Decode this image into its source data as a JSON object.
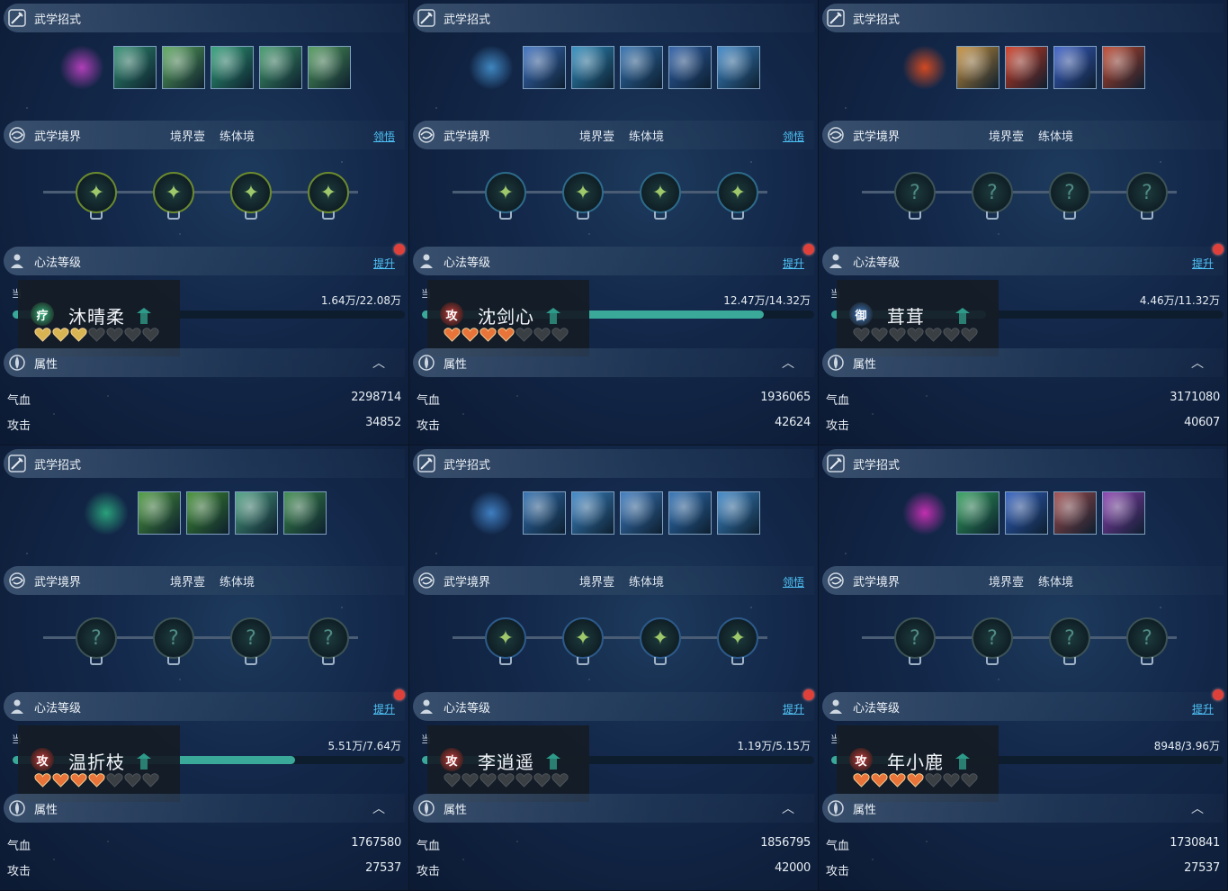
{
  "labels": {
    "skills_title": "武学招式",
    "realm_title": "武学境界",
    "realm_stage": "境界壹",
    "realm_name": "练体境",
    "comprehend_link": "领悟",
    "mind_title": "心法等级",
    "upgrade_link": "提升",
    "attr_title": "属性",
    "stat_hp": "气血",
    "stat_atk": "攻击",
    "progress_start": "当"
  },
  "colors": {
    "accent": "#4fc3f7",
    "progress": "#3aa99a",
    "red_dot": "#e0403a"
  },
  "panels": [
    {
      "name": "沐晴柔",
      "role": "疗",
      "role_color": "#34b37e",
      "progress_text": "1.64万/22.08万",
      "progress_fraction": 0.074,
      "hearts_filled": 3,
      "hearts_color": "#d9b453",
      "hearts_total": 7,
      "hp": "2298714",
      "atk": "34852",
      "show_comprehend": true,
      "realm_unlocked": true,
      "node_color": "#6b8a2e",
      "main_skill_color": "#b03fb8",
      "skill_colors": [
        "#2f8f70",
        "#5aa85a",
        "#2fa078",
        "#3f9a6a",
        "#4f9a5a"
      ],
      "node_icons": [
        "leaf-icon",
        "moon-icon",
        "wave-icon",
        "lotus-icon"
      ]
    },
    {
      "name": "沈剑心",
      "role": "攻",
      "role_color": "#c23b3b",
      "progress_text": "12.47万/14.32万",
      "progress_fraction": 0.871,
      "hearts_filled": 4,
      "hearts_color": "#e8743a",
      "hearts_total": 7,
      "hp": "1936065",
      "atk": "42624",
      "show_comprehend": true,
      "realm_unlocked": true,
      "node_color": "#2d6a8a",
      "main_skill_color": "#3f86c0",
      "skill_colors": [
        "#3a6fc0",
        "#2f8ec0",
        "#3070b0",
        "#2c5fa8",
        "#3a86c8"
      ],
      "node_icons": [
        "sword-slash-icon",
        "swirl-icon",
        "blade-icon",
        "sword-icon"
      ]
    },
    {
      "name": "茸茸",
      "role": "御",
      "role_color": "#3a78c2",
      "progress_text": "4.46万/11.32万",
      "progress_fraction": 0.394,
      "hearts_filled": 0,
      "hearts_color": "#e8743a",
      "hearts_total": 7,
      "hp": "3171080",
      "atk": "40607",
      "show_comprehend": false,
      "realm_unlocked": false,
      "node_color": "#2b4a46",
      "main_skill_color": "#d24a22",
      "skill_colors": [
        "#c8903a",
        "#d23a20",
        "#3a5fc8",
        "#c0442a"
      ],
      "node_icons": [
        "locked-node-icon",
        "locked-node-icon",
        "locked-node-icon",
        "locked-node-icon"
      ]
    },
    {
      "name": "温折枝",
      "role": "攻",
      "role_color": "#c23b3b",
      "progress_text": "5.51万/7.64万",
      "progress_fraction": 0.721,
      "hearts_filled": 4,
      "hearts_color": "#e8743a",
      "hearts_total": 7,
      "hp": "1767580",
      "atk": "27537",
      "show_comprehend": false,
      "realm_unlocked": false,
      "node_color": "#2b4a46",
      "main_skill_color": "#2aa07a",
      "skill_colors": [
        "#4a9a3a",
        "#3f8f30",
        "#4aa080",
        "#3a8a4a"
      ],
      "node_icons": [
        "locked-node-icon",
        "locked-node-icon",
        "locked-node-icon",
        "locked-node-icon"
      ]
    },
    {
      "name": "李逍遥",
      "role": "攻",
      "role_color": "#c23b3b",
      "progress_text": "1.19万/5.15万",
      "progress_fraction": 0.231,
      "hearts_filled": 0,
      "hearts_color": "#e8743a",
      "hearts_total": 7,
      "hp": "1856795",
      "atk": "42000",
      "show_comprehend": true,
      "realm_unlocked": true,
      "node_color": "#2d5a8a",
      "main_skill_color": "#3f7ec0",
      "skill_colors": [
        "#2f6fb0",
        "#3a86c8",
        "#3a7ac0",
        "#2f72b8",
        "#3a86c8"
      ],
      "node_icons": [
        "serpent-icon",
        "feather-icon",
        "swords-icon",
        "flame-icon"
      ]
    },
    {
      "name": "年小鹿",
      "role": "攻",
      "role_color": "#c23b3b",
      "progress_text": "8948/3.96万",
      "progress_fraction": 0.226,
      "hearts_filled": 4,
      "hearts_color": "#e8743a",
      "hearts_total": 7,
      "hp": "1730841",
      "atk": "27537",
      "show_comprehend": false,
      "realm_unlocked": false,
      "node_color": "#2b4a46",
      "main_skill_color": "#c22fb0",
      "skill_colors": [
        "#2fa05a",
        "#2f5fc0",
        "#a04a4a",
        "#8a3fb0"
      ],
      "node_icons": [
        "locked-node-icon",
        "locked-node-icon",
        "locked-node-icon",
        "locked-node-icon"
      ]
    }
  ]
}
